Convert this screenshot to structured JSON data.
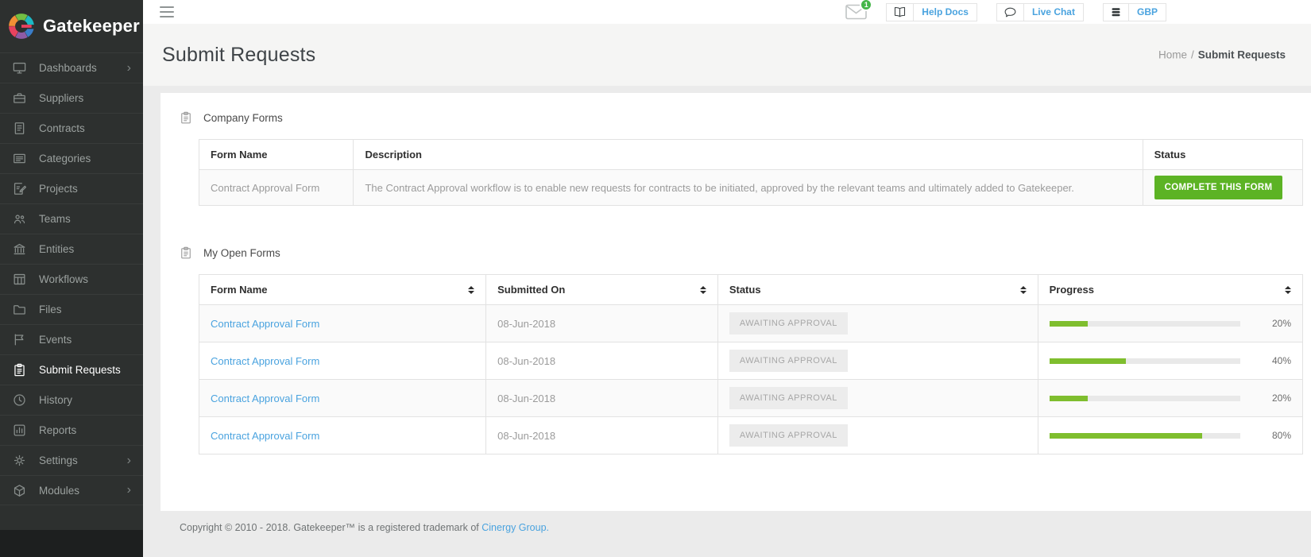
{
  "brand": {
    "name": "Gatekeeper"
  },
  "sidebar": {
    "items": [
      {
        "label": "Dashboards",
        "icon": "dashboards-icon",
        "chevron": true,
        "active": false
      },
      {
        "label": "Suppliers",
        "icon": "suppliers-icon",
        "chevron": false,
        "active": false
      },
      {
        "label": "Contracts",
        "icon": "contracts-icon",
        "chevron": false,
        "active": false
      },
      {
        "label": "Categories",
        "icon": "categories-icon",
        "chevron": false,
        "active": false
      },
      {
        "label": "Projects",
        "icon": "projects-icon",
        "chevron": false,
        "active": false
      },
      {
        "label": "Teams",
        "icon": "teams-icon",
        "chevron": false,
        "active": false
      },
      {
        "label": "Entities",
        "icon": "entities-icon",
        "chevron": false,
        "active": false
      },
      {
        "label": "Workflows",
        "icon": "workflows-icon",
        "chevron": false,
        "active": false
      },
      {
        "label": "Files",
        "icon": "files-icon",
        "chevron": false,
        "active": false
      },
      {
        "label": "Events",
        "icon": "events-icon",
        "chevron": false,
        "active": false
      },
      {
        "label": "Submit Requests",
        "icon": "submit-requests-icon",
        "chevron": false,
        "active": true
      },
      {
        "label": "History",
        "icon": "history-icon",
        "chevron": false,
        "active": false
      },
      {
        "label": "Reports",
        "icon": "reports-icon",
        "chevron": false,
        "active": false
      },
      {
        "label": "Settings",
        "icon": "settings-icon",
        "chevron": true,
        "active": false
      },
      {
        "label": "Modules",
        "icon": "modules-icon",
        "chevron": true,
        "active": false
      }
    ]
  },
  "topbar": {
    "notification_count": "1",
    "help_docs_label": "Help Docs",
    "live_chat_label": "Live Chat",
    "currency_label": "GBP"
  },
  "header": {
    "title": "Submit Requests",
    "breadcrumb": {
      "home": "Home",
      "separator": "/",
      "current": "Submit Requests"
    }
  },
  "company_forms": {
    "title": "Company Forms",
    "columns": {
      "form_name": "Form Name",
      "description": "Description",
      "status": "Status"
    },
    "row": {
      "form_name": "Contract Approval Form",
      "description": "The Contract Approval workflow is to enable new requests for contracts to be initiated, approved by the relevant teams and ultimately added to Gatekeeper.",
      "action_label": "COMPLETE THIS FORM"
    }
  },
  "my_open_forms": {
    "title": "My Open Forms",
    "columns": {
      "form_name": "Form Name",
      "submitted_on": "Submitted On",
      "status": "Status",
      "progress": "Progress"
    },
    "rows": [
      {
        "form_name": "Contract Approval Form",
        "submitted_on": "08-Jun-2018",
        "status": "AWAITING APPROVAL",
        "progress_pct": 20,
        "progress_label": "20%"
      },
      {
        "form_name": "Contract Approval Form",
        "submitted_on": "08-Jun-2018",
        "status": "AWAITING APPROVAL",
        "progress_pct": 40,
        "progress_label": "40%"
      },
      {
        "form_name": "Contract Approval Form",
        "submitted_on": "08-Jun-2018",
        "status": "AWAITING APPROVAL",
        "progress_pct": 20,
        "progress_label": "20%"
      },
      {
        "form_name": "Contract Approval Form",
        "submitted_on": "08-Jun-2018",
        "status": "AWAITING APPROVAL",
        "progress_pct": 80,
        "progress_label": "80%"
      }
    ]
  },
  "footer": {
    "text_before_link": "Copyright © 2010 - 2018. Gatekeeper™ is a registered trademark of ",
    "link_text": "Cinergy Group."
  },
  "colors": {
    "accent_green": "#5cb324",
    "progress_green": "#7fbe2e",
    "link_blue": "#4aa3df",
    "sidebar_bg": "#2d302f",
    "badge_green": "#45b649"
  }
}
